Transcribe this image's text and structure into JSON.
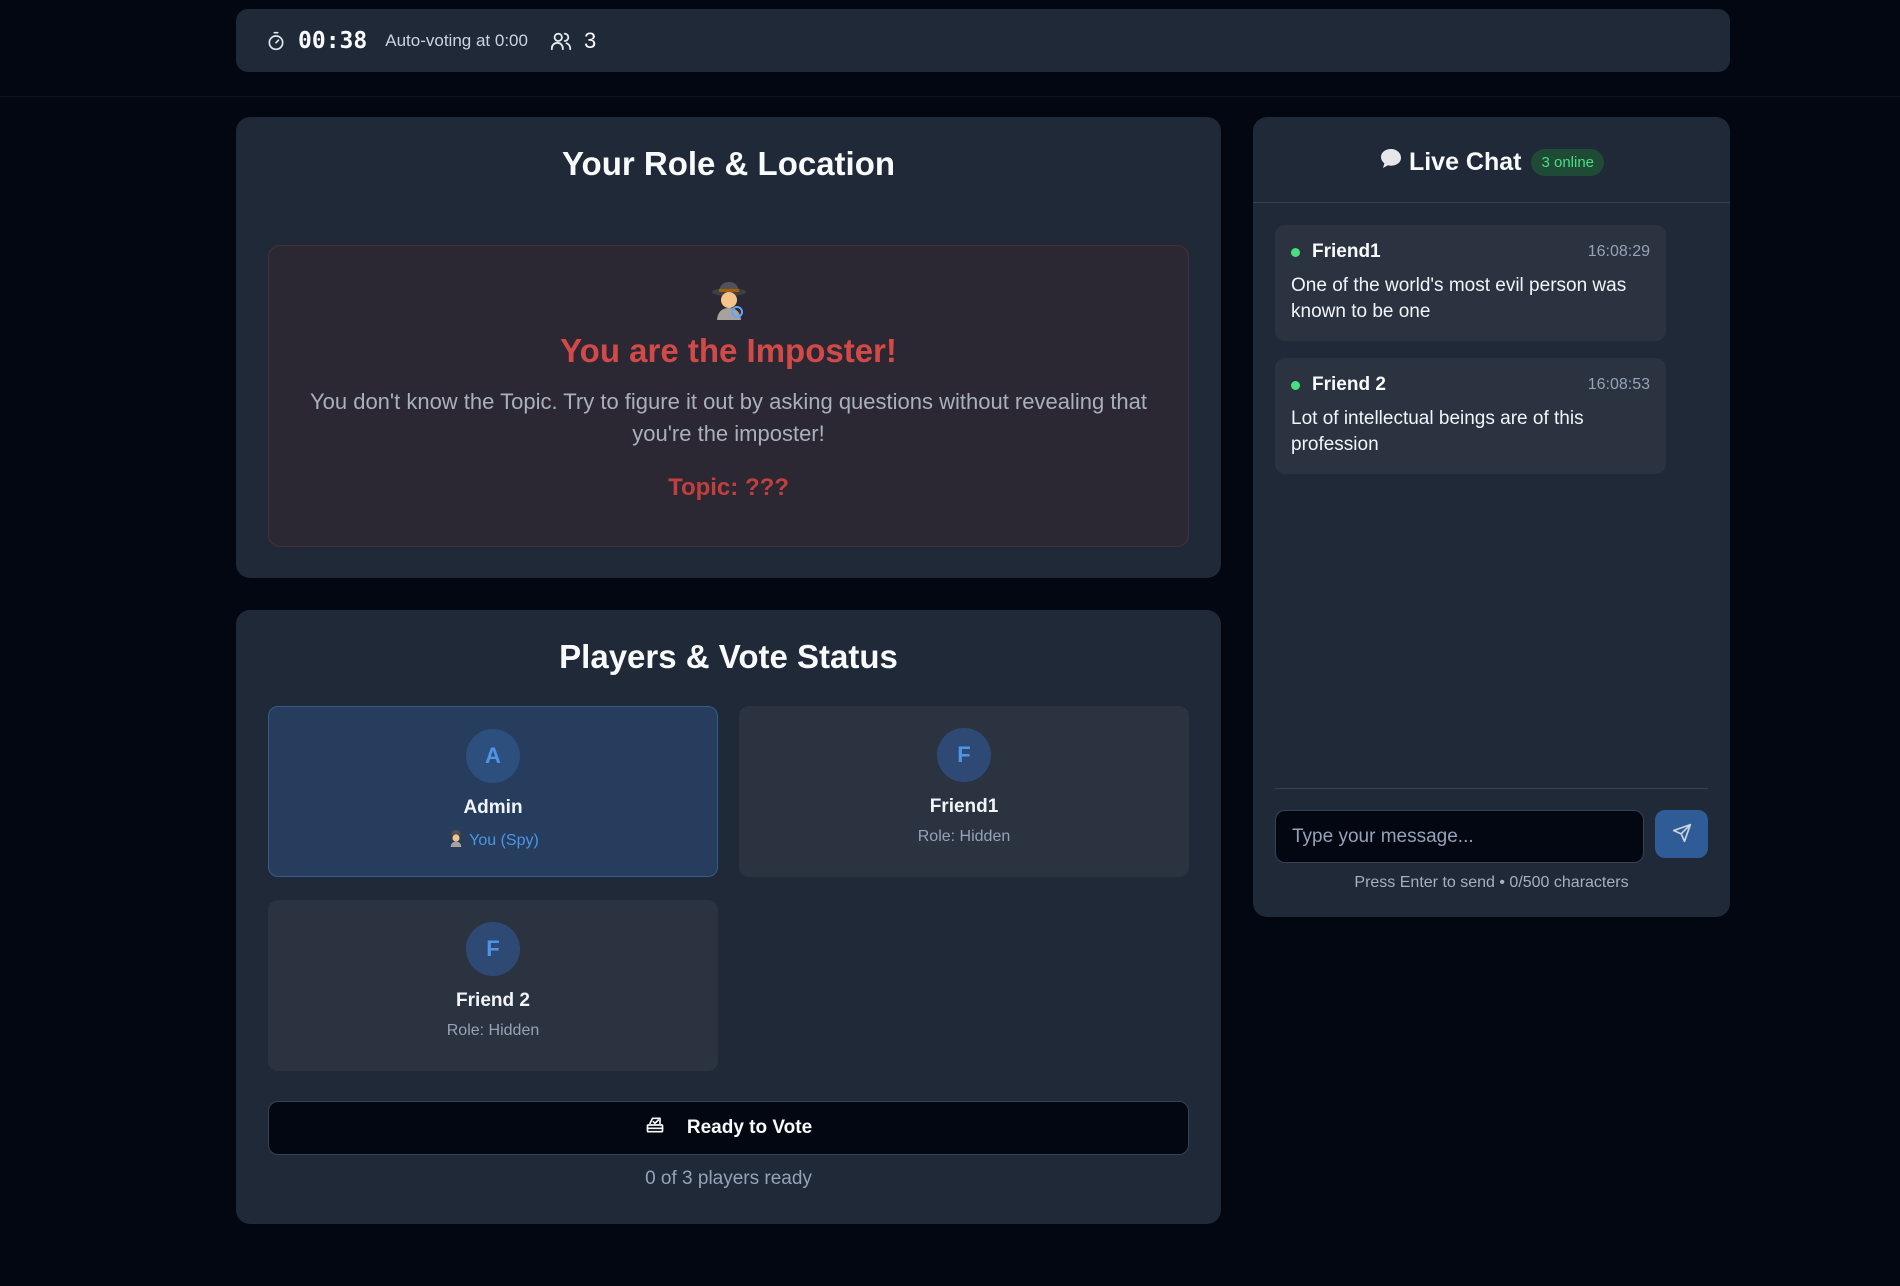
{
  "topbar": {
    "timer": "00:38",
    "auto_voting": "Auto-voting at 0:00",
    "player_count": "3"
  },
  "role_card": {
    "title": "Your Role & Location",
    "imposter_title": "You are the Imposter!",
    "description": "You don't know the Topic. Try to figure it out by asking questions without revealing that you're the imposter!",
    "topic": "Topic: ???"
  },
  "players_card": {
    "title": "Players & Vote Status",
    "players": [
      {
        "initial": "A",
        "name": "Admin",
        "role": "You (Spy)"
      },
      {
        "initial": "F",
        "name": "Friend1",
        "role": "Role: Hidden"
      },
      {
        "initial": "F",
        "name": "Friend 2",
        "role": "Role: Hidden"
      }
    ],
    "vote_button": "Ready to Vote",
    "ready_count": "0 of 3 players ready"
  },
  "chat": {
    "title": "Live Chat",
    "online": "3 online",
    "messages": [
      {
        "author": "Friend1",
        "time": "16:08:29",
        "text": "One of the world's most evil person was known to be one"
      },
      {
        "author": "Friend 2",
        "time": "16:08:53",
        "text": "Lot of intellectual beings are of this profession"
      }
    ],
    "input_placeholder": "Type your message...",
    "hint": "Press Enter to send • 0/500 characters"
  },
  "colors": {
    "background": "#030712",
    "card": "#1f2937",
    "accent": "#4e95e6",
    "imposter_red": "#d24a48",
    "online_green": "#4ade80"
  },
  "icons": [
    "stopwatch-icon",
    "users-icon",
    "spy-icon",
    "speech-bubble-icon",
    "ballot-box-icon",
    "send-icon"
  ]
}
